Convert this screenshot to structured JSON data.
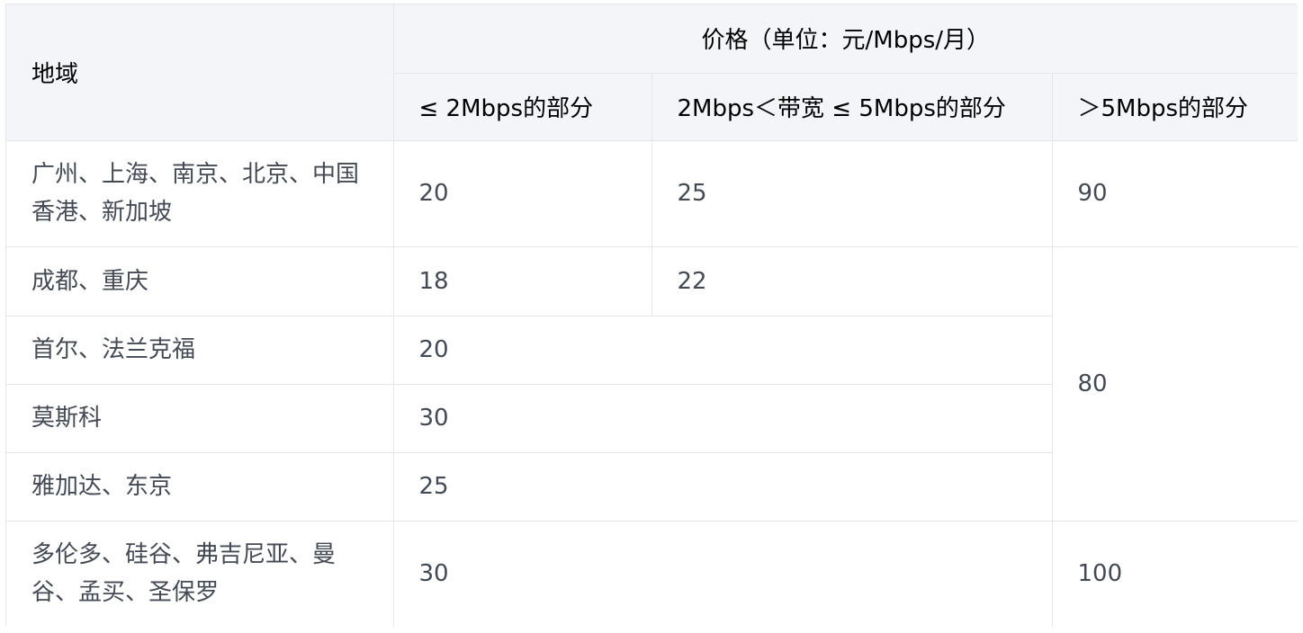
{
  "header": {
    "region": "地域",
    "price": "价格（单位：元/Mbps/月）",
    "tier1": "≤ 2Mbps的部分",
    "tier2": "2Mbps＜带宽 ≤ 5Mbps的部分",
    "tier3": "＞5Mbps的部分"
  },
  "rows": [
    {
      "region": "广州、上海、南京、北京、中国香港、新加坡",
      "tier1": "20",
      "tier2": "25",
      "tier3": "90"
    },
    {
      "region": "成都、重庆",
      "tier1": "18",
      "tier2": "22",
      "tier3": "80"
    },
    {
      "region": "首尔、法兰克福",
      "tier12": "20"
    },
    {
      "region": "莫斯科",
      "tier12": "30"
    },
    {
      "region": "雅加达、东京",
      "tier12": "25"
    },
    {
      "region": "多伦多、硅谷、弗吉尼亚、曼谷、孟买、圣保罗",
      "tier12": "30",
      "tier3": "100"
    }
  ]
}
